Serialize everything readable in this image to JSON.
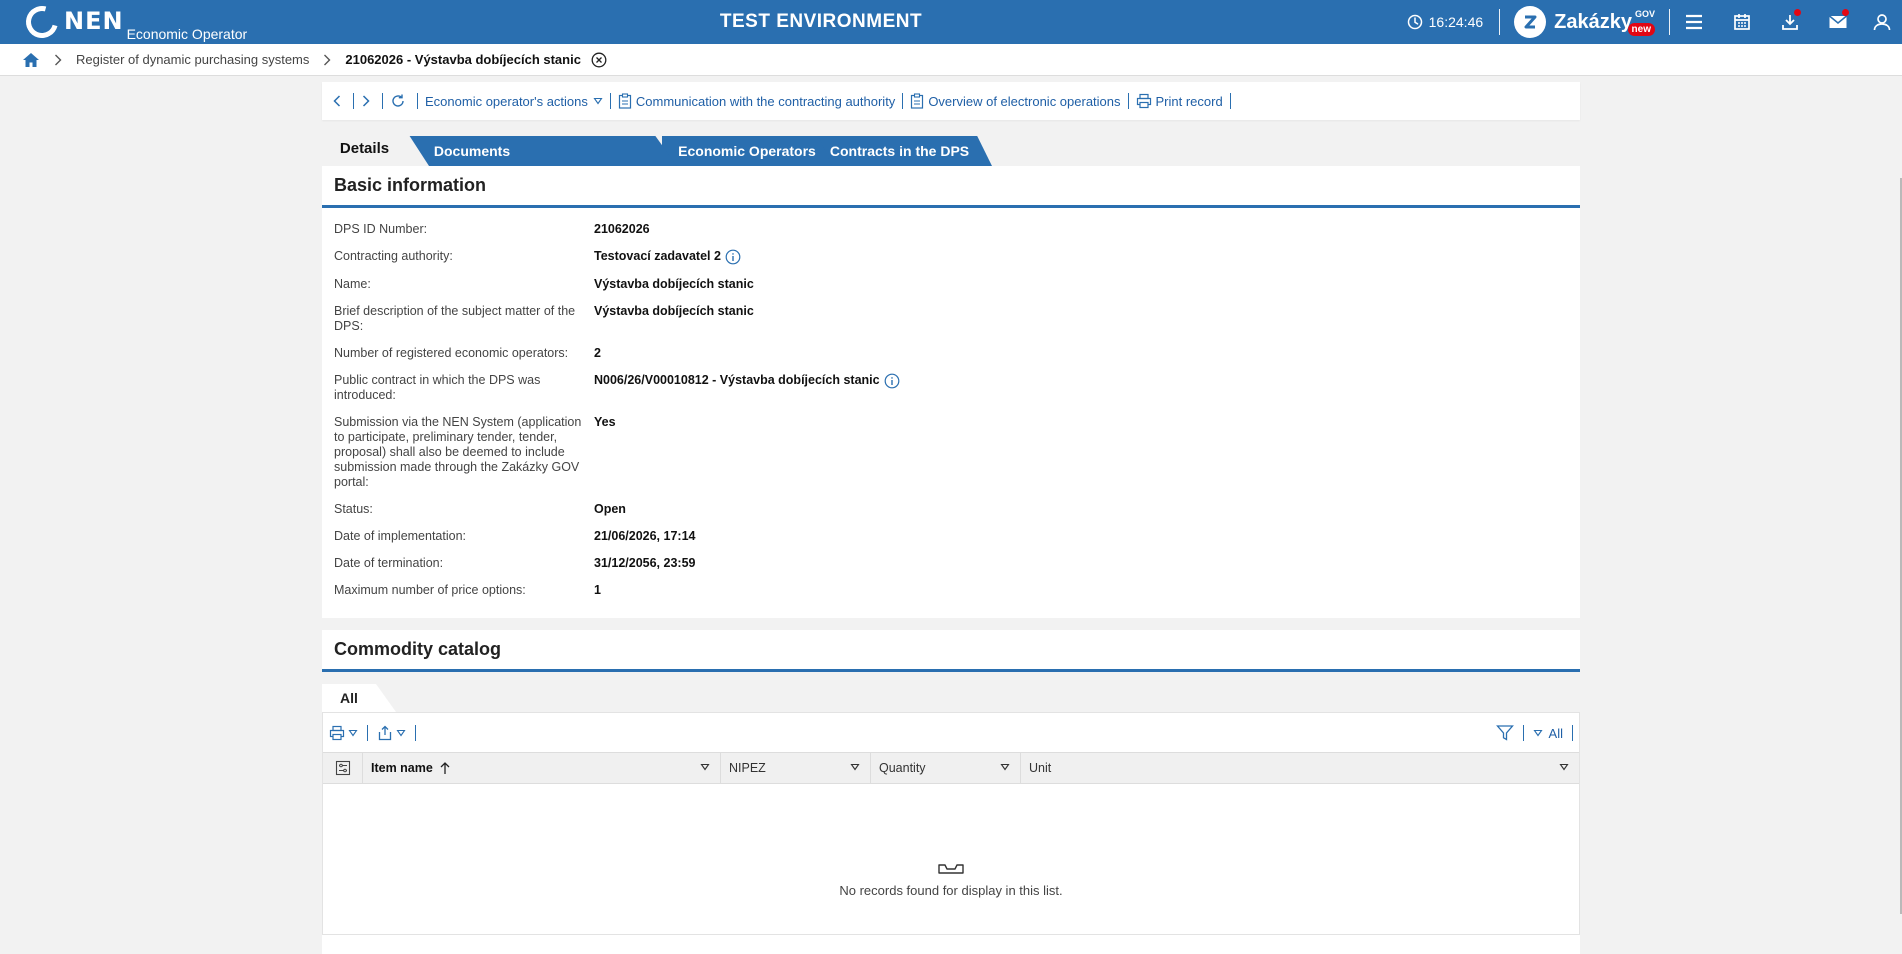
{
  "topbar": {
    "logo_text": "NEN",
    "logo_sub": "Economic Operator",
    "env_title": "TEST ENVIRONMENT",
    "time": "16:24:46",
    "zakazky_label": "Zakázky",
    "zakazky_gov": "GOV",
    "zakazky_new": "new",
    "icons": [
      "menu-icon",
      "calendar-icon",
      "download-icon",
      "mail-icon",
      "user-icon"
    ],
    "brand_color": "#2a6fb0"
  },
  "breadcrumb": {
    "items": [
      "Register of dynamic purchasing systems",
      "21062026 - Výstavba dobíjecích stanic"
    ]
  },
  "toolbar": {
    "actions_label": "Economic operator's actions",
    "communication_label": "Communication with the contracting authority",
    "overview_label": "Overview of electronic operations",
    "print_label": "Print record"
  },
  "tabs": [
    "Details",
    "Documents",
    "Economic Operators",
    "Contracts in the DPS"
  ],
  "basic_info": {
    "title": "Basic information",
    "rows": [
      {
        "label": "DPS ID Number:",
        "value": "21062026"
      },
      {
        "label": "Contracting authority:",
        "value": "Testovací zadavatel 2"
      },
      {
        "label": "Name:",
        "value": "Výstavba dobíjecích stanic"
      },
      {
        "label": "Brief description of the subject matter of the DPS:",
        "value": "Výstavba dobíjecích stanic"
      },
      {
        "label": "Number of registered economic operators:",
        "value": "2"
      },
      {
        "label": "Public contract in which the DPS was introduced:",
        "value": "N006/26/V00010812 - Výstavba dobíjecích stanic"
      },
      {
        "label": "Submission via the NEN System (application to participate, preliminary tender, tender, proposal) shall also be deemed to include submission made through the Zakázky GOV portal:",
        "value": "Yes"
      },
      {
        "label": "Status:",
        "value": "Open"
      },
      {
        "label": "Date of implementation:",
        "value": "21/06/2026, 17:14"
      },
      {
        "label": "Date of termination:",
        "value": "31/12/2056, 23:59"
      },
      {
        "label": "Maximum number of price options:",
        "value": "1"
      }
    ]
  },
  "commodity": {
    "title": "Commodity catalog",
    "subtab": "All",
    "filter_all": "All",
    "columns": [
      "Item name",
      "NIPEZ",
      "Quantity",
      "Unit"
    ],
    "empty_text": "No records found for display in this list."
  }
}
